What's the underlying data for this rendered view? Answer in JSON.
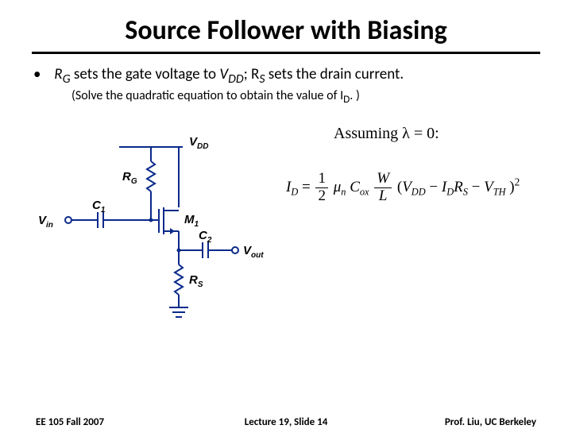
{
  "title": "Source Follower with Biasing",
  "bullet": {
    "pre": "R",
    "sub1": "G",
    "mid1": " sets the gate voltage to ",
    "v": "V",
    "sub2": "DD",
    "mid2": "; R",
    "sub3": "S",
    "post": " sets the drain current."
  },
  "subnote": {
    "pre": "(Solve the quadratic equation to obtain the value of I",
    "sub": "D",
    "post": ". )"
  },
  "assume": {
    "pre": "Assuming ",
    "lam": "λ",
    "post": " = 0:"
  },
  "eq": {
    "I": "I",
    "Dsub": "D",
    "eq": " = ",
    "half_num": "1",
    "half_den": "2",
    "mu": "μ",
    "nsub": "n",
    "C": "C",
    "oxsub": "ox",
    "W": "W",
    "L": "L",
    "lp": "(",
    "V": "V",
    "DDsub": "DD",
    "minus": " − ",
    "Rsub": "R",
    "Ssub": "S",
    "THsub": "TH",
    "rp": ")",
    "sq": "2"
  },
  "circuit": {
    "VDD": "V",
    "DDsub": "DD",
    "RG": "R",
    "Gsub": "G",
    "C1": "C",
    "onesub": "1",
    "Vin": "V",
    "insub": "in",
    "M1": "M",
    "m1sub": "1",
    "C2": "C",
    "twosub": "2",
    "Vout": "V",
    "outsub": "out",
    "RS": "R",
    "Ssub": "S"
  },
  "footer": {
    "left": "EE 105 Fall 2007",
    "center": "Lecture 19, Slide 14",
    "right": "Prof. Liu, UC Berkeley"
  }
}
